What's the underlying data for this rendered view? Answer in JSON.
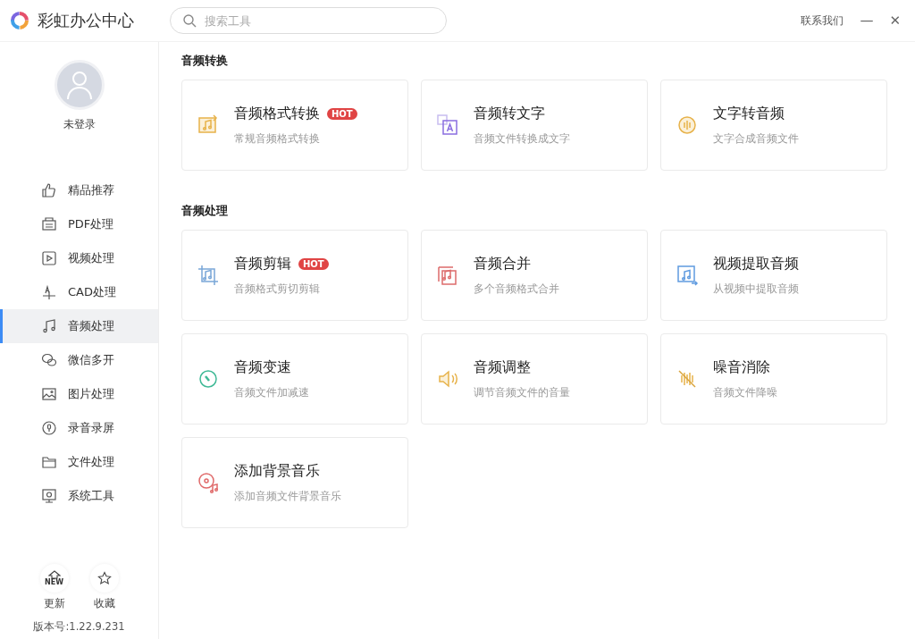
{
  "app": {
    "title": "彩虹办公中心"
  },
  "search": {
    "placeholder": "搜索工具"
  },
  "header": {
    "contact": "联系我们",
    "minimize": "—",
    "close": "✕"
  },
  "user": {
    "name": "未登录"
  },
  "sidebar": {
    "items": [
      {
        "label": "精品推荐",
        "selected": false
      },
      {
        "label": "PDF处理",
        "selected": false
      },
      {
        "label": "视频处理",
        "selected": false
      },
      {
        "label": "CAD处理",
        "selected": false
      },
      {
        "label": "音频处理",
        "selected": true
      },
      {
        "label": "微信多开",
        "selected": false
      },
      {
        "label": "图片处理",
        "selected": false
      },
      {
        "label": "录音录屏",
        "selected": false
      },
      {
        "label": "文件处理",
        "selected": false
      },
      {
        "label": "系统工具",
        "selected": false
      }
    ],
    "update": {
      "badge": "NEW",
      "label": "更新"
    },
    "favorite": {
      "label": "收藏"
    },
    "version": "版本号:1.22.9.231"
  },
  "sections": [
    {
      "title": "音频转换",
      "cards": [
        {
          "title": "音频格式转换",
          "subtitle": "常规音频格式转换",
          "badge": "HOT"
        },
        {
          "title": "音频转文字",
          "subtitle": "音频文件转换成文字"
        },
        {
          "title": "文字转音频",
          "subtitle": "文字合成音频文件"
        }
      ]
    },
    {
      "title": "音频处理",
      "cards": [
        {
          "title": "音频剪辑",
          "subtitle": "音频格式剪切剪辑",
          "badge": "HOT"
        },
        {
          "title": "音频合并",
          "subtitle": "多个音频格式合并"
        },
        {
          "title": "视频提取音频",
          "subtitle": "从视频中提取音频"
        },
        {
          "title": "音频变速",
          "subtitle": "音频文件加减速"
        },
        {
          "title": "音频调整",
          "subtitle": "调节音频文件的音量"
        },
        {
          "title": "噪音消除",
          "subtitle": "音频文件降噪"
        },
        {
          "title": "添加背景音乐",
          "subtitle": "添加音频文件背景音乐"
        }
      ]
    }
  ]
}
